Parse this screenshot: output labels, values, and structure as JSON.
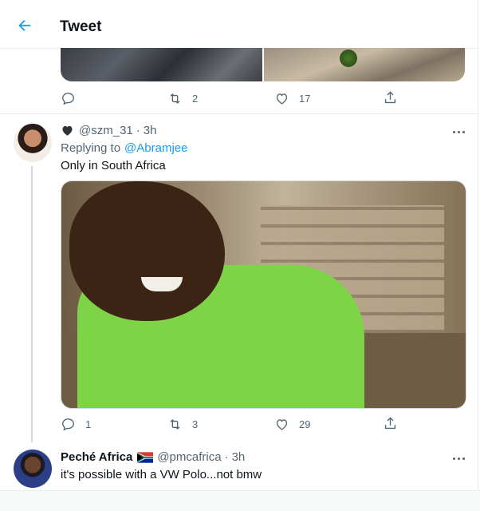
{
  "header": {
    "title": "Tweet"
  },
  "prev_tweet": {
    "actions": {
      "reply": "",
      "retweet": "2",
      "like": "17"
    }
  },
  "reply_tweet": {
    "name": "",
    "handle": "@szm_31",
    "time": "3h",
    "replying_prefix": "Replying to",
    "replying_handle": "@Abramjee",
    "text": "Only in South Africa",
    "actions": {
      "reply": "1",
      "retweet": "3",
      "like": "29"
    }
  },
  "next_tweet": {
    "name": "Peché Africa",
    "handle": "@pmcafrica",
    "time": "3h",
    "text": "it's possible with a VW Polo...not bmw"
  },
  "colors": {
    "accent": "#1d9bf0",
    "muted": "#536471",
    "border": "#e6ecf0",
    "heart_emoji": "#2f3336"
  }
}
